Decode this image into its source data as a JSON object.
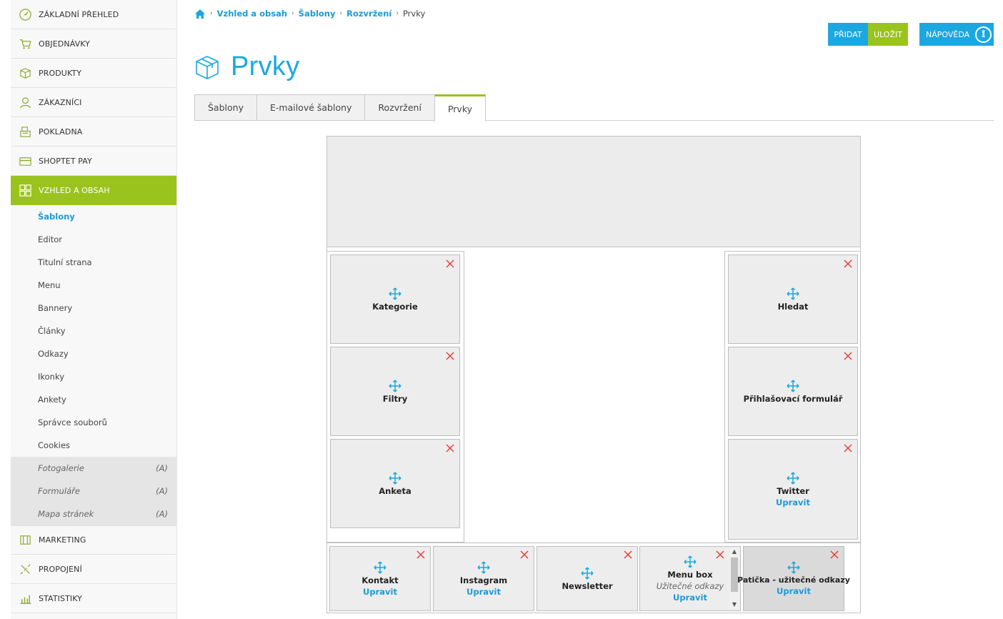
{
  "sidebar": {
    "items_top": [
      {
        "label": "ZÁKLADNÍ PŘEHLED",
        "icon": "dashboard-icon"
      },
      {
        "label": "OBJEDNÁVKY",
        "icon": "cart-icon"
      },
      {
        "label": "PRODUKTY",
        "icon": "box-icon"
      },
      {
        "label": "ZÁKAZNÍCI",
        "icon": "user-icon"
      },
      {
        "label": "POKLADNA",
        "icon": "cash-register-icon"
      },
      {
        "label": "SHOPTET PAY",
        "icon": "card-icon"
      },
      {
        "label": "VZHLED A OBSAH",
        "icon": "layout-grid-icon",
        "active": true
      }
    ],
    "sub_items": [
      "Šablony",
      "Editor",
      "Titulní strana",
      "Menu",
      "Bannery",
      "Články",
      "Odkazy",
      "Ikonky",
      "Ankety",
      "Správce souborů",
      "Cookies"
    ],
    "addon_items": [
      {
        "label": "Fotogalerie",
        "badge": "(A)"
      },
      {
        "label": "Formuláře",
        "badge": "(A)"
      },
      {
        "label": "Mapa stránek",
        "badge": "(A)"
      }
    ],
    "items_bottom": [
      {
        "label": "MARKETING",
        "icon": "megaphone-icon"
      },
      {
        "label": "PROPOJENÍ",
        "icon": "plug-icon"
      },
      {
        "label": "STATISTIKY",
        "icon": "chart-icon"
      }
    ]
  },
  "breadcrumb": {
    "items": [
      "Vzhled a obsah",
      "Šablony",
      "Rozvržení"
    ],
    "current": "Prvky",
    "separator": "›"
  },
  "toolbar": {
    "add_label": "PŘIDAT",
    "save_label": "ULOŽIT",
    "help_label": "NÁPOVĚDA",
    "help_glyph": "i"
  },
  "page": {
    "title": "Prvky"
  },
  "tabs": [
    "Šablony",
    "E-mailové šablony",
    "Rozvržení",
    "Prvky"
  ],
  "layout": {
    "left_column": [
      {
        "title": "Kategorie"
      },
      {
        "title": "Filtry"
      },
      {
        "title": "Anketa"
      }
    ],
    "right_column": [
      {
        "title": "Hledat"
      },
      {
        "title": "Přihlašovací formulář"
      },
      {
        "title": "Twitter",
        "edit": "Upravit"
      }
    ],
    "footer": [
      {
        "title": "Kontakt",
        "edit": "Upravit"
      },
      {
        "title": "Instagram",
        "edit": "Upravit"
      },
      {
        "title": "Newsletter"
      },
      {
        "title": "Menu box",
        "sub": "Užitečné odkazy",
        "edit": "Upravit"
      },
      {
        "title": "Patička - užitečné odkazy",
        "edit": "Upravit"
      }
    ]
  },
  "colors": {
    "accent_blue": "#1ba8e0",
    "accent_green": "#9bc31e",
    "remove_red": "#e53935"
  }
}
